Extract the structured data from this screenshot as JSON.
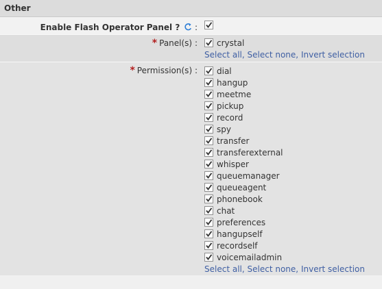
{
  "section": {
    "title": "Other"
  },
  "flash_panel": {
    "label": "Enable Flash Operator Panel ?",
    "colon": ":",
    "checked": true
  },
  "panels": {
    "required_mark": "*",
    "label": "Panel(s)",
    "colon": ":",
    "options": [
      {
        "label": "crystal",
        "checked": true
      }
    ],
    "links": {
      "select_all": "Select all",
      "select_none": "Select none",
      "invert": "Invert selection",
      "sep": ","
    }
  },
  "permissions": {
    "required_mark": "*",
    "label": "Permission(s)",
    "colon": ":",
    "options": [
      {
        "label": "dial",
        "checked": true
      },
      {
        "label": "hangup",
        "checked": true
      },
      {
        "label": "meetme",
        "checked": true
      },
      {
        "label": "pickup",
        "checked": true
      },
      {
        "label": "record",
        "checked": true
      },
      {
        "label": "spy",
        "checked": true
      },
      {
        "label": "transfer",
        "checked": true
      },
      {
        "label": "transferexternal",
        "checked": true
      },
      {
        "label": "whisper",
        "checked": true
      },
      {
        "label": "queuemanager",
        "checked": true
      },
      {
        "label": "queueagent",
        "checked": true
      },
      {
        "label": "phonebook",
        "checked": true
      },
      {
        "label": "chat",
        "checked": true
      },
      {
        "label": "preferences",
        "checked": true
      },
      {
        "label": "hangupself",
        "checked": true
      },
      {
        "label": "recordself",
        "checked": true
      },
      {
        "label": "voicemailadmin",
        "checked": true
      }
    ],
    "links": {
      "select_all": "Select all",
      "select_none": "Select none",
      "invert": "Invert selection",
      "sep": ","
    }
  },
  "colors": {
    "link": "#3f5fa3",
    "required": "#b21f1f",
    "refresh_icon": "#2f7fd6"
  }
}
